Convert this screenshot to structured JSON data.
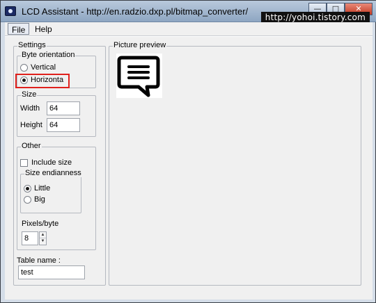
{
  "window": {
    "title": "LCD Assistant -  http://en.radzio.dxp.pl/bitmap_converter/",
    "buttons": {
      "minimize": "—",
      "maximize": "□",
      "close": "✕"
    },
    "watermark": "http://yohoi.tistory.com"
  },
  "menu": {
    "file": "File",
    "help": "Help"
  },
  "settings": {
    "title": "Settings",
    "byte_orientation": {
      "title": "Byte orientation",
      "options": [
        "Vertical",
        "Horizonta"
      ],
      "selected": "Horizonta"
    },
    "size": {
      "title": "Size",
      "width_label": "Width",
      "width_value": "64",
      "height_label": "Height",
      "height_value": "64"
    },
    "other": {
      "title": "Other",
      "include_size_label": "Include size",
      "include_size_checked": false,
      "endianness": {
        "title": "Size endianness",
        "options": [
          "Little",
          "Big"
        ],
        "selected": "Little"
      },
      "pixels_per_byte_label": "Pixels/byte",
      "pixels_per_byte_value": "8"
    },
    "table_name_label": "Table name :",
    "table_name_value": "test"
  },
  "preview": {
    "title": "Picture preview",
    "image_icon": "speech-bubble-icon"
  },
  "colors": {
    "highlight": "#e0201c",
    "title_bar": "#8ea6c2"
  }
}
